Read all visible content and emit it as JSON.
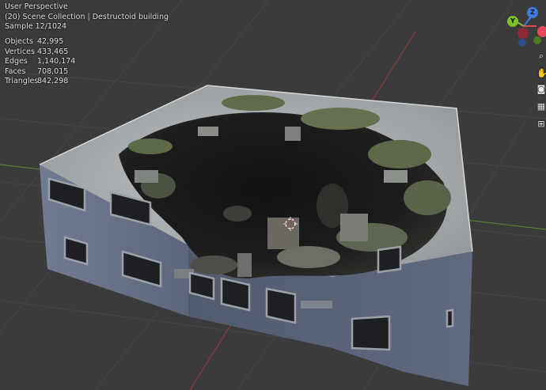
{
  "viewport": {
    "view_name": "User Perspective",
    "scene_info": "(20) Scene Collection | Destructoid building",
    "render_sample": "Sample 12/1024"
  },
  "stats": [
    {
      "label": "Objects",
      "value": "42,995"
    },
    {
      "label": "Vertices",
      "value": "433,465"
    },
    {
      "label": "Edges",
      "value": "1,140,174"
    },
    {
      "label": "Faces",
      "value": "708,015"
    },
    {
      "label": "Triangles",
      "value": "842,298"
    }
  ],
  "gizmo": {
    "y_label": "Y",
    "z_label": "Z",
    "colors": {
      "x": "#e24a5a",
      "y": "#7fbf2f",
      "z": "#3c7ee0",
      "neg_x": "#8a2a35",
      "neg_y": "#4c7a20",
      "neg_z": "#2a4f8c"
    }
  },
  "toolbar_icons": [
    "zoom-icon",
    "hand-pan-icon",
    "camera-view-icon",
    "grid-toggle-icon",
    "perspective-toggle-icon"
  ],
  "colors": {
    "background": "#3b3b3b",
    "grid": "#454545",
    "x_axis": "#9a3a3a",
    "y_axis": "#5c8a2c",
    "wall": "#6f7890",
    "roof": "#aeb2b5"
  }
}
